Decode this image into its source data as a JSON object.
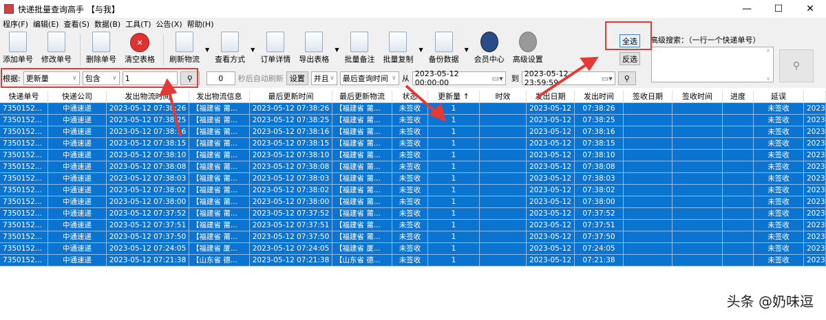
{
  "window": {
    "title": "快递批量查询高手 【与我】",
    "minimize": "—",
    "maximize": "☐",
    "close": "✕"
  },
  "menu": [
    "程序(F)",
    "编辑(E)",
    "查看(S)",
    "数据(B)",
    "工具(T)",
    "公告(X)",
    "帮助(H)"
  ],
  "toolbar": {
    "add": "添加单号",
    "edit": "修改单号",
    "delete": "删除单号",
    "clear": "清空表格",
    "refresh": "刷新物流",
    "view": "查看方式",
    "detail": "订单详情",
    "export": "导出表格",
    "note": "批量备注",
    "copy": "批量复制",
    "backup": "备份数据",
    "member": "会员中心",
    "settings": "高级设置"
  },
  "filter": {
    "label": "根据:",
    "field": "更新量",
    "op": "包含",
    "value": "1",
    "seconds": "0",
    "auto_refresh": "秒后自动刷新",
    "set": "设置",
    "logic": "并且",
    "time_field": "最后查询时间",
    "from": "从",
    "from_value": "2023-05-12 00:00:00",
    "to": "到",
    "to_value": "2023-05-12 23:59:59"
  },
  "selection": {
    "select_all": "全选",
    "invert": "反选"
  },
  "advanced": {
    "label": "高级搜索：（一行一个快递单号）"
  },
  "table": {
    "headers": [
      "快递单号",
      "快递公司",
      "发出物流时间",
      "发出物流信息",
      "最后更新时间",
      "最后更新物流",
      "状态",
      "更新量 ↑",
      "时效",
      "发出日期",
      "发出时间",
      "签收日期",
      "签收时间",
      "进度",
      "延误",
      ""
    ],
    "rows": [
      [
        "7350152...",
        "中通速递",
        "2023-05-12 07:38:26",
        "【福建省 莆...",
        "2023-05-12 07:38:26",
        "【福建省 莆...",
        "未签收",
        "1",
        "",
        "2023-05-12",
        "07:38:26",
        "",
        "",
        "",
        "未签收",
        "2023"
      ],
      [
        "7350152...",
        "中通速递",
        "2023-05-12 07:38:25",
        "【福建省 莆...",
        "2023-05-12 07:38:25",
        "【福建省 莆...",
        "未签收",
        "1",
        "",
        "2023-05-12",
        "07:38:25",
        "",
        "",
        "",
        "未签收",
        "2023"
      ],
      [
        "7350152...",
        "中通速递",
        "2023-05-12 07:38:16",
        "【福建省 莆...",
        "2023-05-12 07:38:16",
        "【福建省 莆...",
        "未签收",
        "1",
        "",
        "2023-05-12",
        "07:38:16",
        "",
        "",
        "",
        "未签收",
        "2023"
      ],
      [
        "7350152...",
        "中通速递",
        "2023-05-12 07:38:15",
        "【福建省 莆...",
        "2023-05-12 07:38:15",
        "【福建省 莆...",
        "未签收",
        "1",
        "",
        "2023-05-12",
        "07:38:15",
        "",
        "",
        "",
        "未签收",
        "2023"
      ],
      [
        "7350152...",
        "中通速递",
        "2023-05-12 07:38:10",
        "【福建省 莆...",
        "2023-05-12 07:38:10",
        "【福建省 莆...",
        "未签收",
        "1",
        "",
        "2023-05-12",
        "07:38:10",
        "",
        "",
        "",
        "未签收",
        "2023"
      ],
      [
        "7350152...",
        "中通速递",
        "2023-05-12 07:38:08",
        "【福建省 莆...",
        "2023-05-12 07:38:08",
        "【福建省 莆...",
        "未签收",
        "1",
        "",
        "2023-05-12",
        "07:38:08",
        "",
        "",
        "",
        "未签收",
        "2023"
      ],
      [
        "7350152...",
        "中通速递",
        "2023-05-12 07:38:03",
        "【福建省 莆...",
        "2023-05-12 07:38:03",
        "【福建省 莆...",
        "未签收",
        "1",
        "",
        "2023-05-12",
        "07:38:03",
        "",
        "",
        "",
        "未签收",
        "2023"
      ],
      [
        "7350152...",
        "中通速递",
        "2023-05-12 07:38:02",
        "【福建省 莆...",
        "2023-05-12 07:38:02",
        "【福建省 莆...",
        "未签收",
        "1",
        "",
        "2023-05-12",
        "07:38:02",
        "",
        "",
        "",
        "未签收",
        "2023"
      ],
      [
        "7350152...",
        "中通速递",
        "2023-05-12 07:38:00",
        "【福建省 莆...",
        "2023-05-12 07:38:00",
        "【福建省 莆...",
        "未签收",
        "1",
        "",
        "2023-05-12",
        "07:38:00",
        "",
        "",
        "",
        "未签收",
        "2023"
      ],
      [
        "7350152...",
        "中通速递",
        "2023-05-12 07:37:52",
        "【福建省 莆...",
        "2023-05-12 07:37:52",
        "【福建省 莆...",
        "未签收",
        "1",
        "",
        "2023-05-12",
        "07:37:52",
        "",
        "",
        "",
        "未签收",
        "2023"
      ],
      [
        "7350152...",
        "中通速递",
        "2023-05-12 07:37:51",
        "【福建省 莆...",
        "2023-05-12 07:37:51",
        "【福建省 莆...",
        "未签收",
        "1",
        "",
        "2023-05-12",
        "07:37:51",
        "",
        "",
        "",
        "未签收",
        "2023"
      ],
      [
        "7350152...",
        "中通速递",
        "2023-05-12 07:37:50",
        "【福建省 莆...",
        "2023-05-12 07:37:50",
        "【福建省 莆...",
        "未签收",
        "1",
        "",
        "2023-05-12",
        "07:37:50",
        "",
        "",
        "",
        "未签收",
        "2023"
      ],
      [
        "7350152...",
        "中通速递",
        "2023-05-12 07:24:05",
        "【福建省 厦...",
        "2023-05-12 07:24:05",
        "【福建省 厦...",
        "未签收",
        "1",
        "",
        "2023-05-12",
        "07:24:05",
        "",
        "",
        "",
        "未签收",
        "2023"
      ],
      [
        "7350152...",
        "中通速递",
        "2023-05-12 07:21:38",
        "【山东省 德...",
        "2023-05-12 07:21:38",
        "【山东省 德...",
        "未签收",
        "1",
        "",
        "2023-05-12",
        "07:21:38",
        "",
        "",
        "",
        "未签收",
        "2023"
      ]
    ]
  },
  "watermark": "头条 @奶味逗",
  "colors": {
    "selection": "#0a74d0",
    "annotation": "#e53935"
  }
}
